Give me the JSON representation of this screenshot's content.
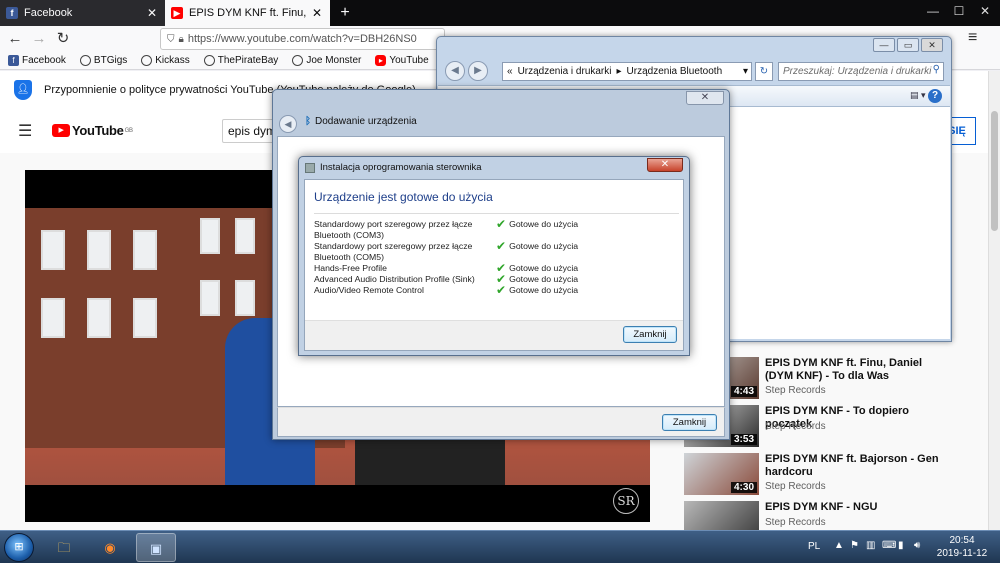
{
  "browser": {
    "tabs": [
      {
        "title": "Facebook",
        "icon": "facebook-icon",
        "close": "✕"
      },
      {
        "title": "EPIS DYM KNF ft. Finu, Dani",
        "icon": "youtube-icon",
        "close": "✕"
      }
    ],
    "new_tab": "+",
    "window_controls": {
      "minimize": "—",
      "maximize": "☐",
      "close": "✕"
    },
    "url": "https://www.youtube.com/watch?v=DBH26NS0",
    "bookmarks": [
      {
        "label": "Facebook",
        "icon": "facebook-icon"
      },
      {
        "label": "BTGigs",
        "icon": "globe-icon"
      },
      {
        "label": "Kickass",
        "icon": "globe-icon"
      },
      {
        "label": "ThePirateBay",
        "icon": "globe-icon"
      },
      {
        "label": "Joe Monster",
        "icon": "globe-icon"
      },
      {
        "label": "YouTube",
        "icon": "youtube-icon"
      },
      {
        "label": "syberia",
        "icon": "globe-icon"
      }
    ]
  },
  "youtube": {
    "privacy_notice": "Przypomnienie o polityce prywatności YouTube (YouTube należy do Google)",
    "logo": "YouTube",
    "logo_region": "GB",
    "search_value": "epis dym",
    "signin_label": "SIĘ",
    "watermark": "SR",
    "recommendations": [
      {
        "title": "EPIS DYM KNF ft. Finu, Daniel (DYM KNF) - To dla Was",
        "channel": "Step Records",
        "duration": "4:43"
      },
      {
        "title": "EPIS DYM KNF - To dopiero początek",
        "channel": "Step Records",
        "duration": "3:53"
      },
      {
        "title": "EPIS DYM KNF ft. Bajorson - Gen hardcoru",
        "channel": "Step Records",
        "duration": "4:30"
      },
      {
        "title": "EPIS DYM KNF - NGU",
        "channel": "Step Records",
        "duration": ""
      }
    ]
  },
  "explorer": {
    "breadcrumb": [
      "«",
      "Urządzenia i drukarki",
      "▸",
      "Urządzenia Bluetooth"
    ],
    "search_placeholder": "Przeszukaj: Urządzenia i drukarki"
  },
  "wizard": {
    "title": "Dodawanie urządzenia",
    "close_label": "✕",
    "close_button": "Zamknij"
  },
  "install": {
    "title": "Instalacja oprogramowania sterownika",
    "close_label": "✕",
    "heading": "Urządzenie jest gotowe do użycia",
    "rows": [
      {
        "name": "Standardowy port szeregowy przez łącze Bluetooth (COM3)",
        "status": "Gotowe do użycia"
      },
      {
        "name": "Standardowy port szeregowy przez łącze Bluetooth (COM5)",
        "status": "Gotowe do użycia"
      },
      {
        "name": "Hands-Free Profile",
        "status": "Gotowe do użycia"
      },
      {
        "name": "Advanced Audio Distribution Profile (Sink)",
        "status": "Gotowe do użycia"
      },
      {
        "name": "Audio/Video Remote Control",
        "status": "Gotowe do użycia"
      }
    ],
    "close_button": "Zamknij"
  },
  "taskbar": {
    "language": "PL",
    "time": "20:54",
    "date": "2019-11-12"
  },
  "colors": {
    "youtube_red": "#ff0000",
    "facebook_blue": "#3b5998",
    "win7_heading": "#1e3f8a",
    "check_green": "#2fa52a"
  }
}
